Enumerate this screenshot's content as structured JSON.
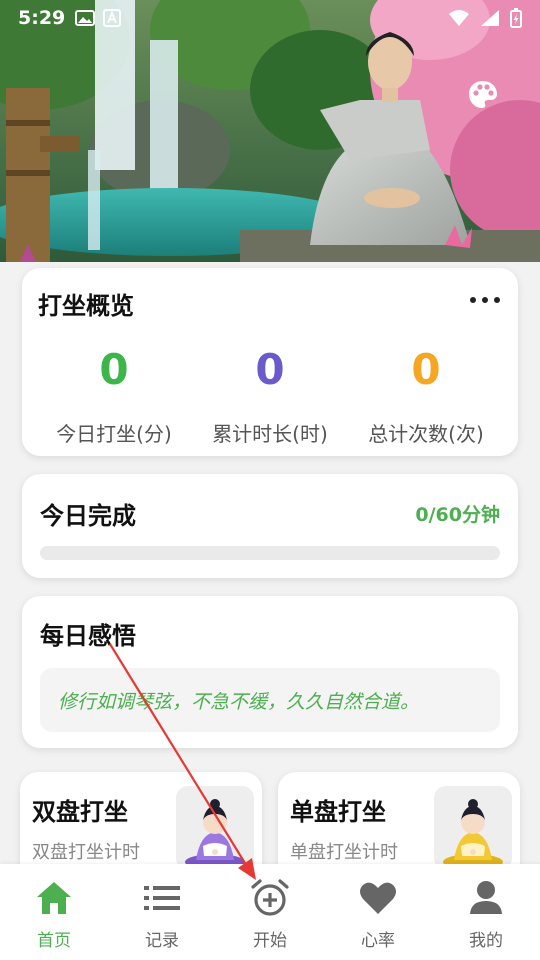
{
  "status_bar": {
    "time": "5:29",
    "left_icons": [
      "image-icon",
      "a-icon"
    ],
    "right_icons": [
      "wifi-icon",
      "signal-icon",
      "battery-charging-icon"
    ]
  },
  "hero": {
    "scene": "meditating-monk-by-waterfall",
    "palette_icon": "palette-icon"
  },
  "overview": {
    "title": "打坐概览",
    "more_icon": "more-horizontal-icon",
    "stats": [
      {
        "value": "0",
        "label": "今日打坐(分)",
        "color": "#3cb54a"
      },
      {
        "value": "0",
        "label": "累计时长(时)",
        "color": "#6a5acd"
      },
      {
        "value": "0",
        "label": "总计次数(次)",
        "color": "#f5a623"
      }
    ]
  },
  "today": {
    "title": "今日完成",
    "progress_text": "0/60分钟",
    "progress_fraction": 0
  },
  "insight": {
    "title": "每日感悟",
    "quote": "修行如调琴弦，不急不缓，久久自然合道。"
  },
  "modes": [
    {
      "title": "双盘打坐",
      "subtitle": "双盘打坐计时"
    },
    {
      "title": "单盘打坐",
      "subtitle": "单盘打坐计时"
    }
  ],
  "nav": {
    "items": [
      {
        "label": "首页",
        "icon": "home-icon",
        "active": true
      },
      {
        "label": "记录",
        "icon": "list-icon",
        "active": false
      },
      {
        "label": "开始",
        "icon": "alarm-add-icon",
        "active": false
      },
      {
        "label": "心率",
        "icon": "heart-icon",
        "active": false
      },
      {
        "label": "我的",
        "icon": "person-icon",
        "active": false
      }
    ]
  },
  "colors": {
    "accent": "#4caf50",
    "nav_inactive": "#666666",
    "annotation_arrow": "#e53935"
  }
}
